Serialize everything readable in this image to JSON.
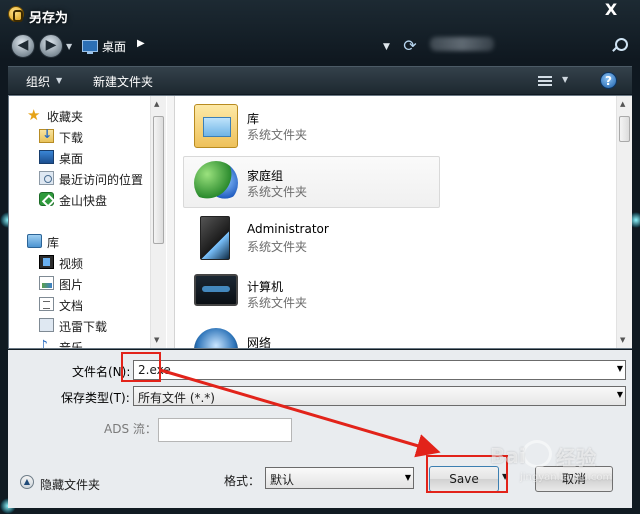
{
  "window": {
    "title": "另存为",
    "close_glyph": "X"
  },
  "address": {
    "location": "桌面",
    "chevron": "▶"
  },
  "toolbar": {
    "organize": "组织",
    "new_folder": "新建文件夹",
    "help": "?"
  },
  "nav_pane": {
    "items": [
      {
        "label": "收藏夹",
        "icon": "star-icon"
      },
      {
        "label": "下载",
        "icon": "downloads-folder-icon"
      },
      {
        "label": "桌面",
        "icon": "desktop-icon"
      },
      {
        "label": "最近访问的位置",
        "icon": "recent-places-icon"
      },
      {
        "label": "金山快盘",
        "icon": "kuaipan-icon"
      },
      {
        "label": "库",
        "icon": "library-icon"
      },
      {
        "label": "视频",
        "icon": "video-icon"
      },
      {
        "label": "图片",
        "icon": "pictures-icon"
      },
      {
        "label": "文档",
        "icon": "documents-icon"
      },
      {
        "label": "迅雷下载",
        "icon": "xunlei-download-icon"
      },
      {
        "label": "音乐",
        "icon": "music-icon"
      }
    ]
  },
  "content": {
    "items": [
      {
        "name": "库",
        "sub": "系统文件夹",
        "icon": "library-large-icon"
      },
      {
        "name": "家庭组",
        "sub": "系统文件夹",
        "icon": "homegroup-icon"
      },
      {
        "name": "Administrator",
        "sub": "系统文件夹",
        "icon": "user-folder-icon"
      },
      {
        "name": "计算机",
        "sub": "系统文件夹",
        "icon": "computer-icon"
      },
      {
        "name": "网络",
        "sub": "",
        "icon": "network-icon"
      }
    ]
  },
  "form": {
    "filename_label": "文件名(N):",
    "filename_value": "2.exe",
    "filetype_label": "保存类型(T):",
    "filetype_value": "所有文件 (*.*)",
    "ads_label": "ADS 流：",
    "ads_value": "",
    "format_label": "格式：",
    "format_value": "默认"
  },
  "footer": {
    "hide_folders": "隐藏文件夹",
    "save": "Save",
    "cancel": "取消"
  },
  "watermark": {
    "text": "Bai",
    "text2": "经验",
    "sub": "jingyan.baidu.com"
  }
}
